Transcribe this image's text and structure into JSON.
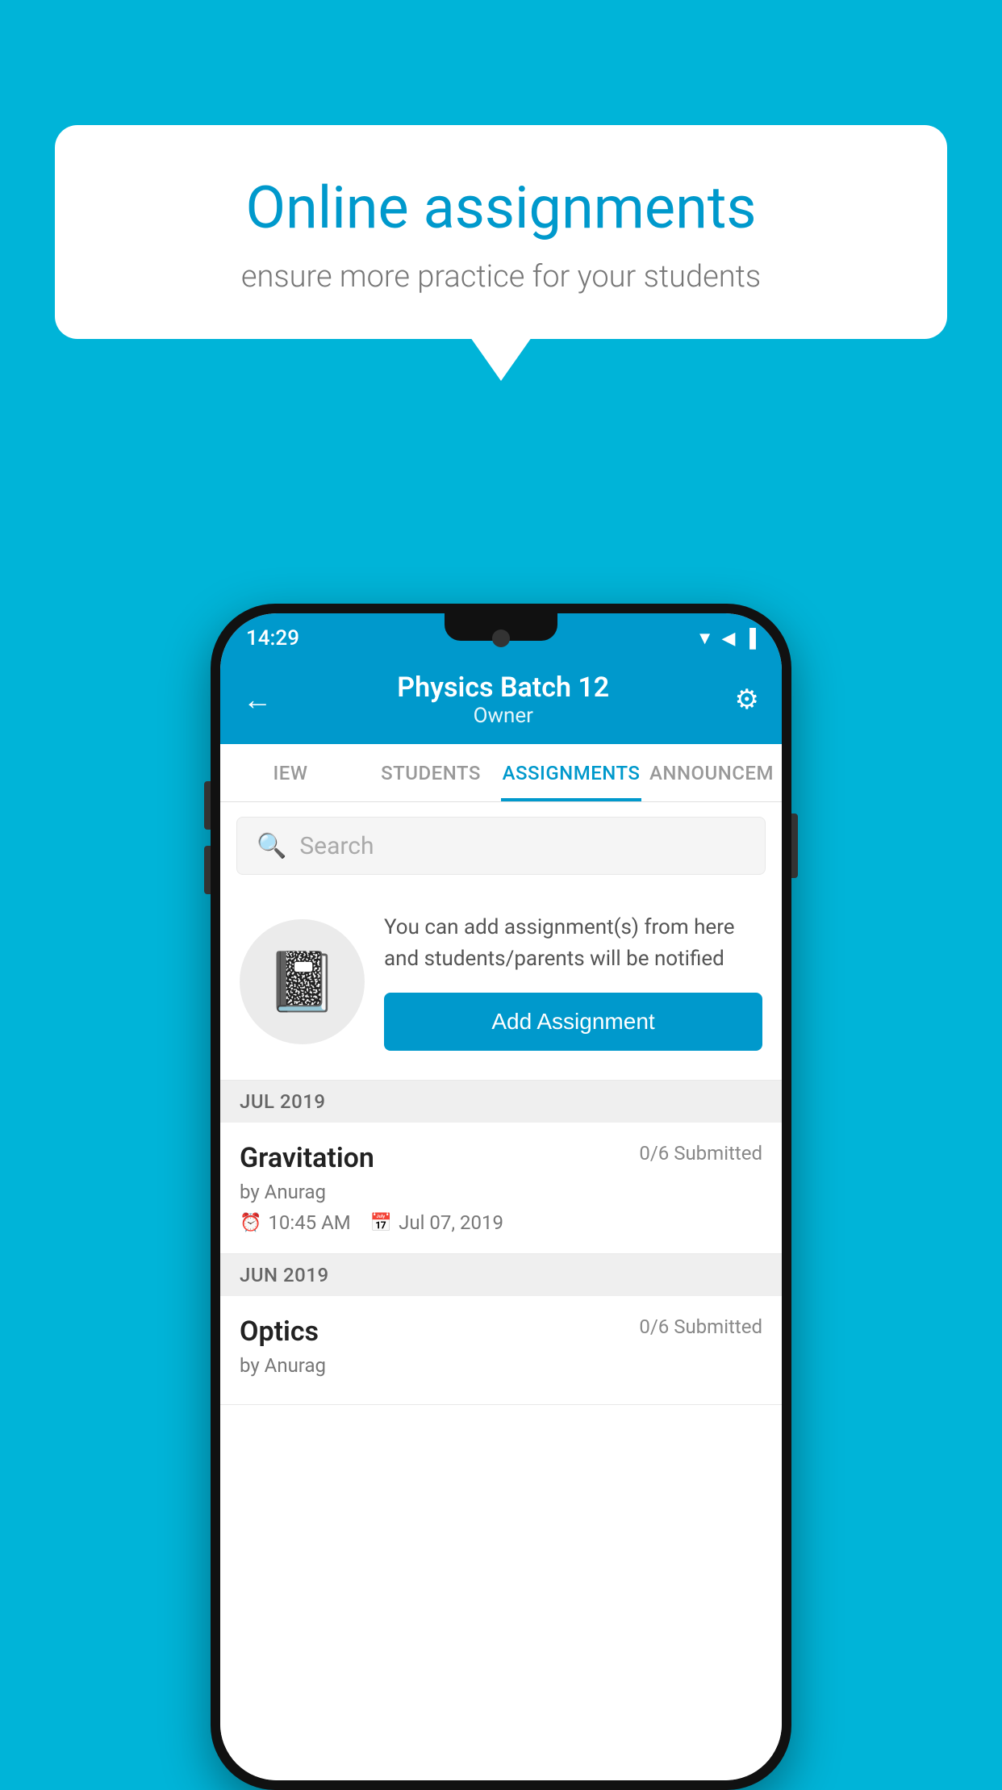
{
  "background_color": "#00b4d8",
  "speech_bubble": {
    "title": "Online assignments",
    "subtitle": "ensure more practice for your students"
  },
  "status_bar": {
    "time": "14:29",
    "icons": [
      "wifi",
      "signal",
      "battery"
    ]
  },
  "header": {
    "title": "Physics Batch 12",
    "subtitle": "Owner",
    "back_label": "←",
    "settings_label": "⚙"
  },
  "tabs": [
    {
      "label": "IEW",
      "active": false
    },
    {
      "label": "STUDENTS",
      "active": false
    },
    {
      "label": "ASSIGNMENTS",
      "active": true
    },
    {
      "label": "ANNOUNCEM",
      "active": false
    }
  ],
  "search": {
    "placeholder": "Search"
  },
  "promo": {
    "description": "You can add assignment(s) from here and students/parents will be notified",
    "button_label": "Add Assignment"
  },
  "assignments": [
    {
      "month": "JUL 2019",
      "items": [
        {
          "title": "Gravitation",
          "submitted": "0/6 Submitted",
          "by": "by Anurag",
          "time": "10:45 AM",
          "date": "Jul 07, 2019"
        }
      ]
    },
    {
      "month": "JUN 2019",
      "items": [
        {
          "title": "Optics",
          "submitted": "0/6 Submitted",
          "by": "by Anurag",
          "time": "",
          "date": ""
        }
      ]
    }
  ]
}
